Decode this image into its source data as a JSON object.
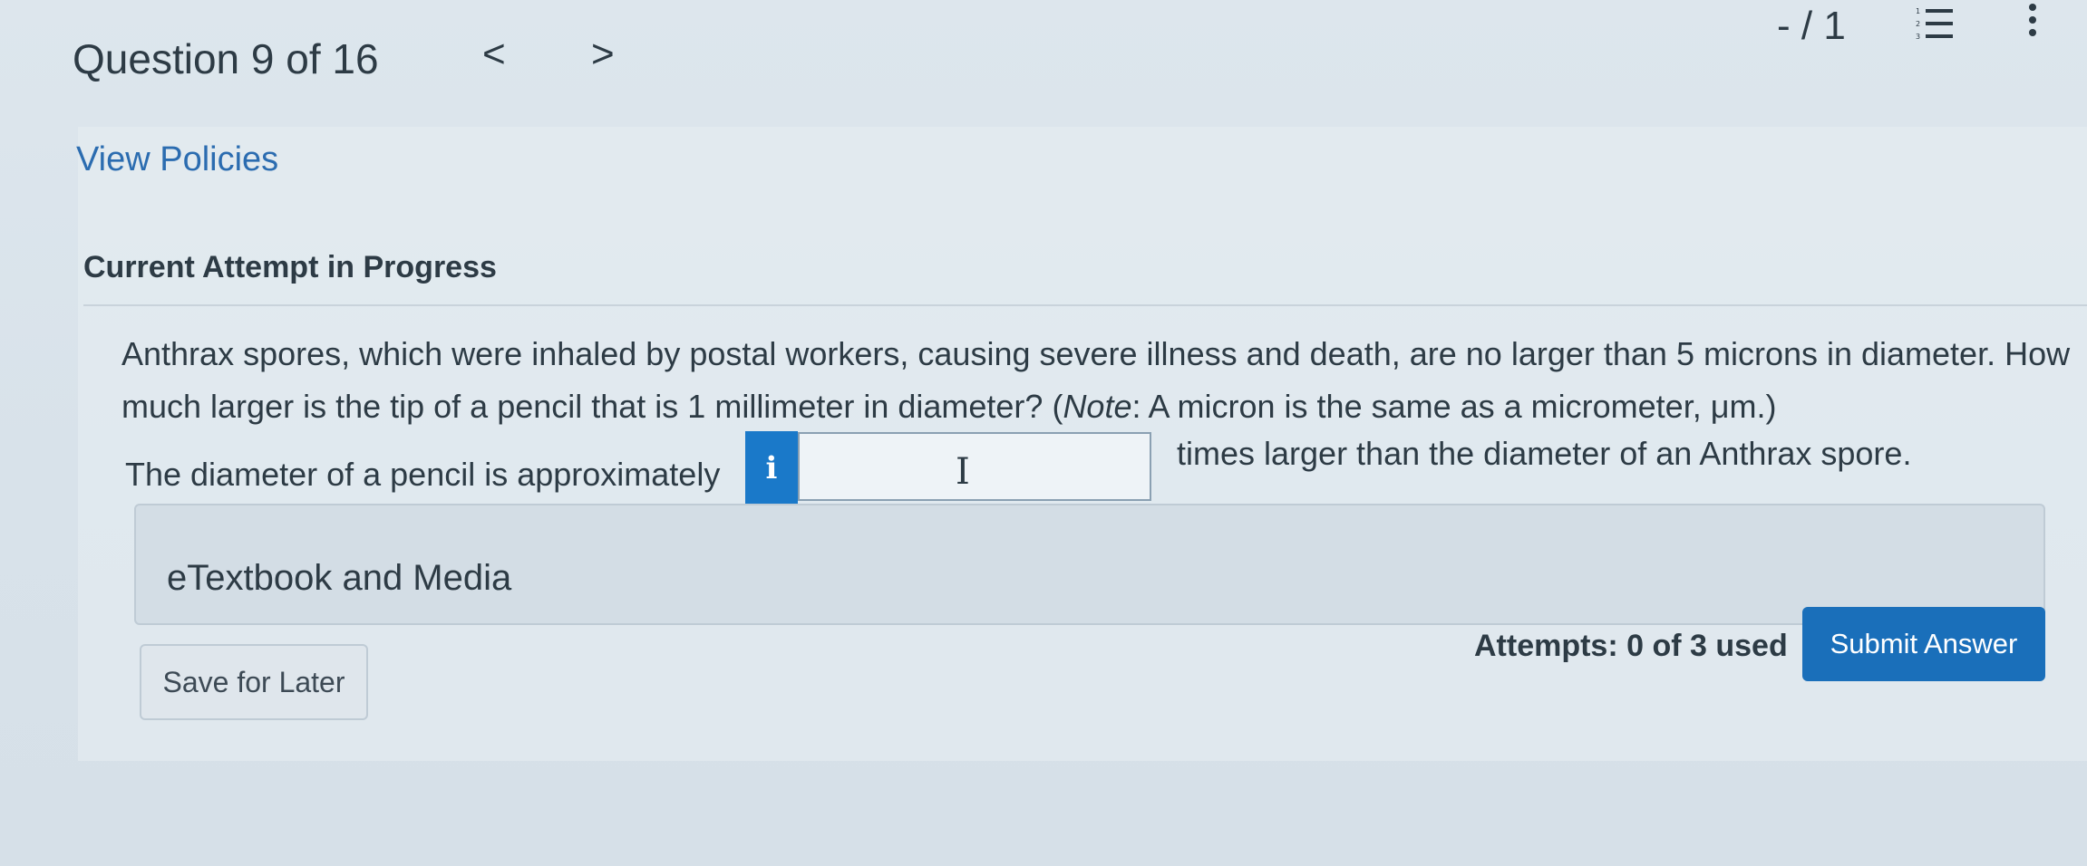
{
  "header": {
    "question_label": "Question 9 of 16",
    "prev_glyph": "<",
    "next_glyph": ">",
    "score": "- / 1"
  },
  "links": {
    "view_policies": "View Policies"
  },
  "attempt": {
    "heading": "Current Attempt in Progress"
  },
  "question": {
    "text_before_note": "Anthrax spores, which were inhaled by postal workers, causing severe illness and death, are no larger than 5 microns in diameter. How much larger is the tip of a pencil that is 1 millimeter in diameter? (",
    "note_label": "Note",
    "text_after_note": ": A micron is the same as a micrometer, μm.)"
  },
  "answer": {
    "lead_text": "The diameter of a pencil is approximately",
    "info_glyph": "i",
    "value": "",
    "caret_glyph": "I",
    "tail_text": "times larger than the diameter of an Anthrax spore."
  },
  "resources": {
    "etextbook_label": "eTextbook and Media"
  },
  "footer": {
    "save_label": "Save for Later",
    "attempts_text": "Attempts: 0 of 3 used",
    "submit_label": "Submit Answer"
  },
  "icons": {
    "list": "numbered-list-icon",
    "menu": "kebab-menu-icon"
  },
  "colors": {
    "link": "#2b6cb0",
    "primary_button": "#1a6fba",
    "info_button": "#1a79c9",
    "text": "#2d3b45"
  }
}
